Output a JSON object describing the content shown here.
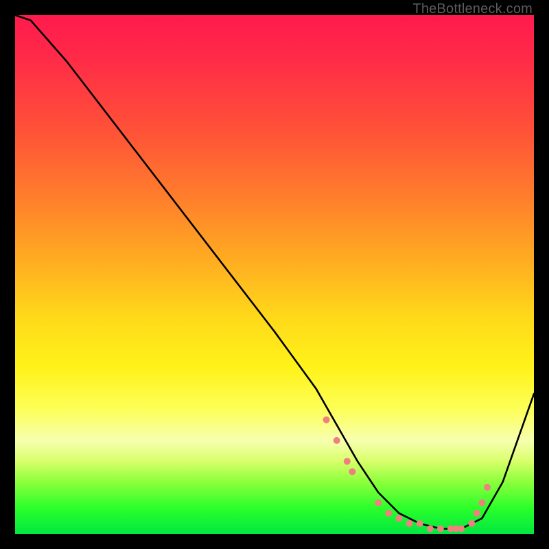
{
  "watermark": "TheBottleneck.com",
  "chart_data": {
    "type": "line",
    "title": "",
    "xlabel": "",
    "ylabel": "",
    "xlim": [
      0,
      100
    ],
    "ylim": [
      0,
      100
    ],
    "series": [
      {
        "name": "curve",
        "x": [
          0,
          3,
          10,
          20,
          30,
          40,
          50,
          58,
          62,
          66,
          70,
          74,
          78,
          82,
          86,
          90,
          94,
          100
        ],
        "y": [
          100,
          99,
          91,
          78,
          65,
          52,
          39,
          28,
          21,
          14,
          8,
          4,
          2,
          1,
          1,
          3,
          10,
          27
        ]
      }
    ],
    "markers": {
      "name": "dots",
      "color": "#f08080",
      "x": [
        60,
        62,
        64,
        65,
        70,
        72,
        74,
        76,
        78,
        80,
        82,
        84,
        85,
        86,
        88,
        89,
        90,
        91
      ],
      "y": [
        22,
        18,
        14,
        12,
        6,
        4,
        3,
        2,
        2,
        1,
        1,
        1,
        1,
        1,
        2,
        4,
        6,
        9
      ]
    }
  }
}
